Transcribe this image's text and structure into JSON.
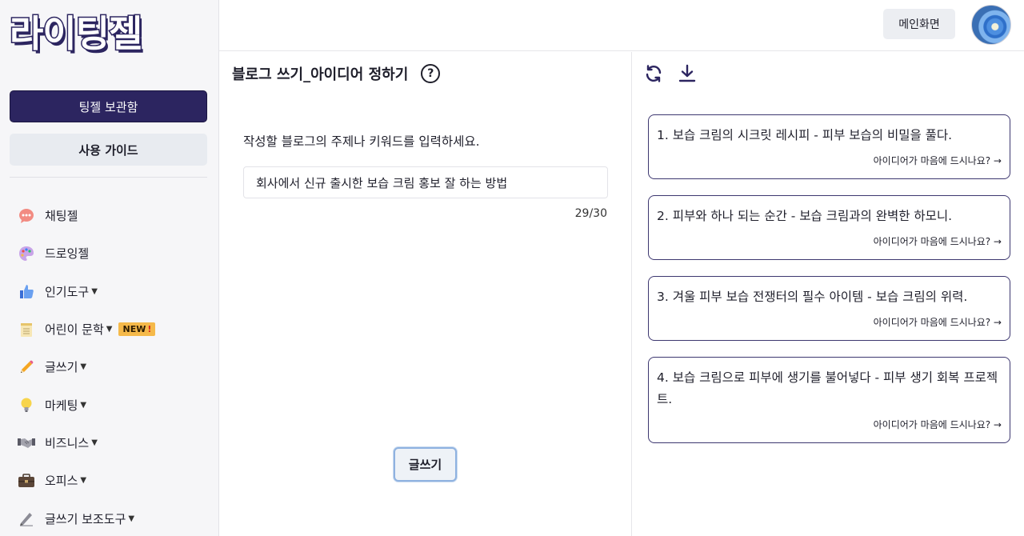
{
  "logo": {
    "text": "라이팅젤"
  },
  "sidebar": {
    "primary_button": "팅젤 보관함",
    "secondary_button": "사용 가이드",
    "items": [
      {
        "label": "채팅젤",
        "icon": "chat-bubble-icon",
        "dropdown": false
      },
      {
        "label": "드로잉젤",
        "icon": "palette-icon",
        "dropdown": false
      },
      {
        "label": "인기도구",
        "icon": "thumbs-up-icon",
        "dropdown": true
      },
      {
        "label": "어린이 문학",
        "icon": "notepad-icon",
        "dropdown": true,
        "badge": "NEW",
        "badge_mark": "!"
      },
      {
        "label": "글쓰기",
        "icon": "pencil-icon",
        "dropdown": true
      },
      {
        "label": "마케팅",
        "icon": "light-bulb-icon",
        "dropdown": true
      },
      {
        "label": "비즈니스",
        "icon": "handshake-icon",
        "dropdown": true
      },
      {
        "label": "오피스",
        "icon": "briefcase-icon",
        "dropdown": true
      },
      {
        "label": "글쓰기 보조도구",
        "icon": "pen-icon",
        "dropdown": true
      }
    ]
  },
  "topbar": {
    "home_button": "메인화면"
  },
  "main": {
    "title": "블로그 쓰기_아이디어 정하기",
    "help": "?",
    "prompt_label": "작성할 블로그의 주제나 키워드를 입력하세요.",
    "input_value": "회사에서 신규 출시한 보습 크림 홍보 잘 하는 방법",
    "counter": "29/30",
    "submit_button": "글쓰기"
  },
  "results": {
    "cards": [
      {
        "text": "1. 보습 크림의 시크릿 레시피 - 피부 보습의 비밀을 풀다.",
        "footer": "아이디어가 마음에 드시나요? →"
      },
      {
        "text": "2. 피부와 하나 되는 순간 - 보습 크림과의 완벽한 하모니.",
        "footer": "아이디어가 마음에 드시나요? →"
      },
      {
        "text": "3. 겨울 피부 보습 전쟁터의 필수 아이템 - 보습 크림의 위력.",
        "footer": "아이디어가 마음에 드시나요? →"
      },
      {
        "text": "4. 보습 크림으로 피부에 생기를 불어넣다 - 피부 생기 회복 프로젝트.",
        "footer": "아이디어가 마음에 드시나요? →"
      }
    ]
  },
  "colors": {
    "brand": "#2c2560",
    "card_border": "#3d3770",
    "badge": "#f5b94a"
  }
}
